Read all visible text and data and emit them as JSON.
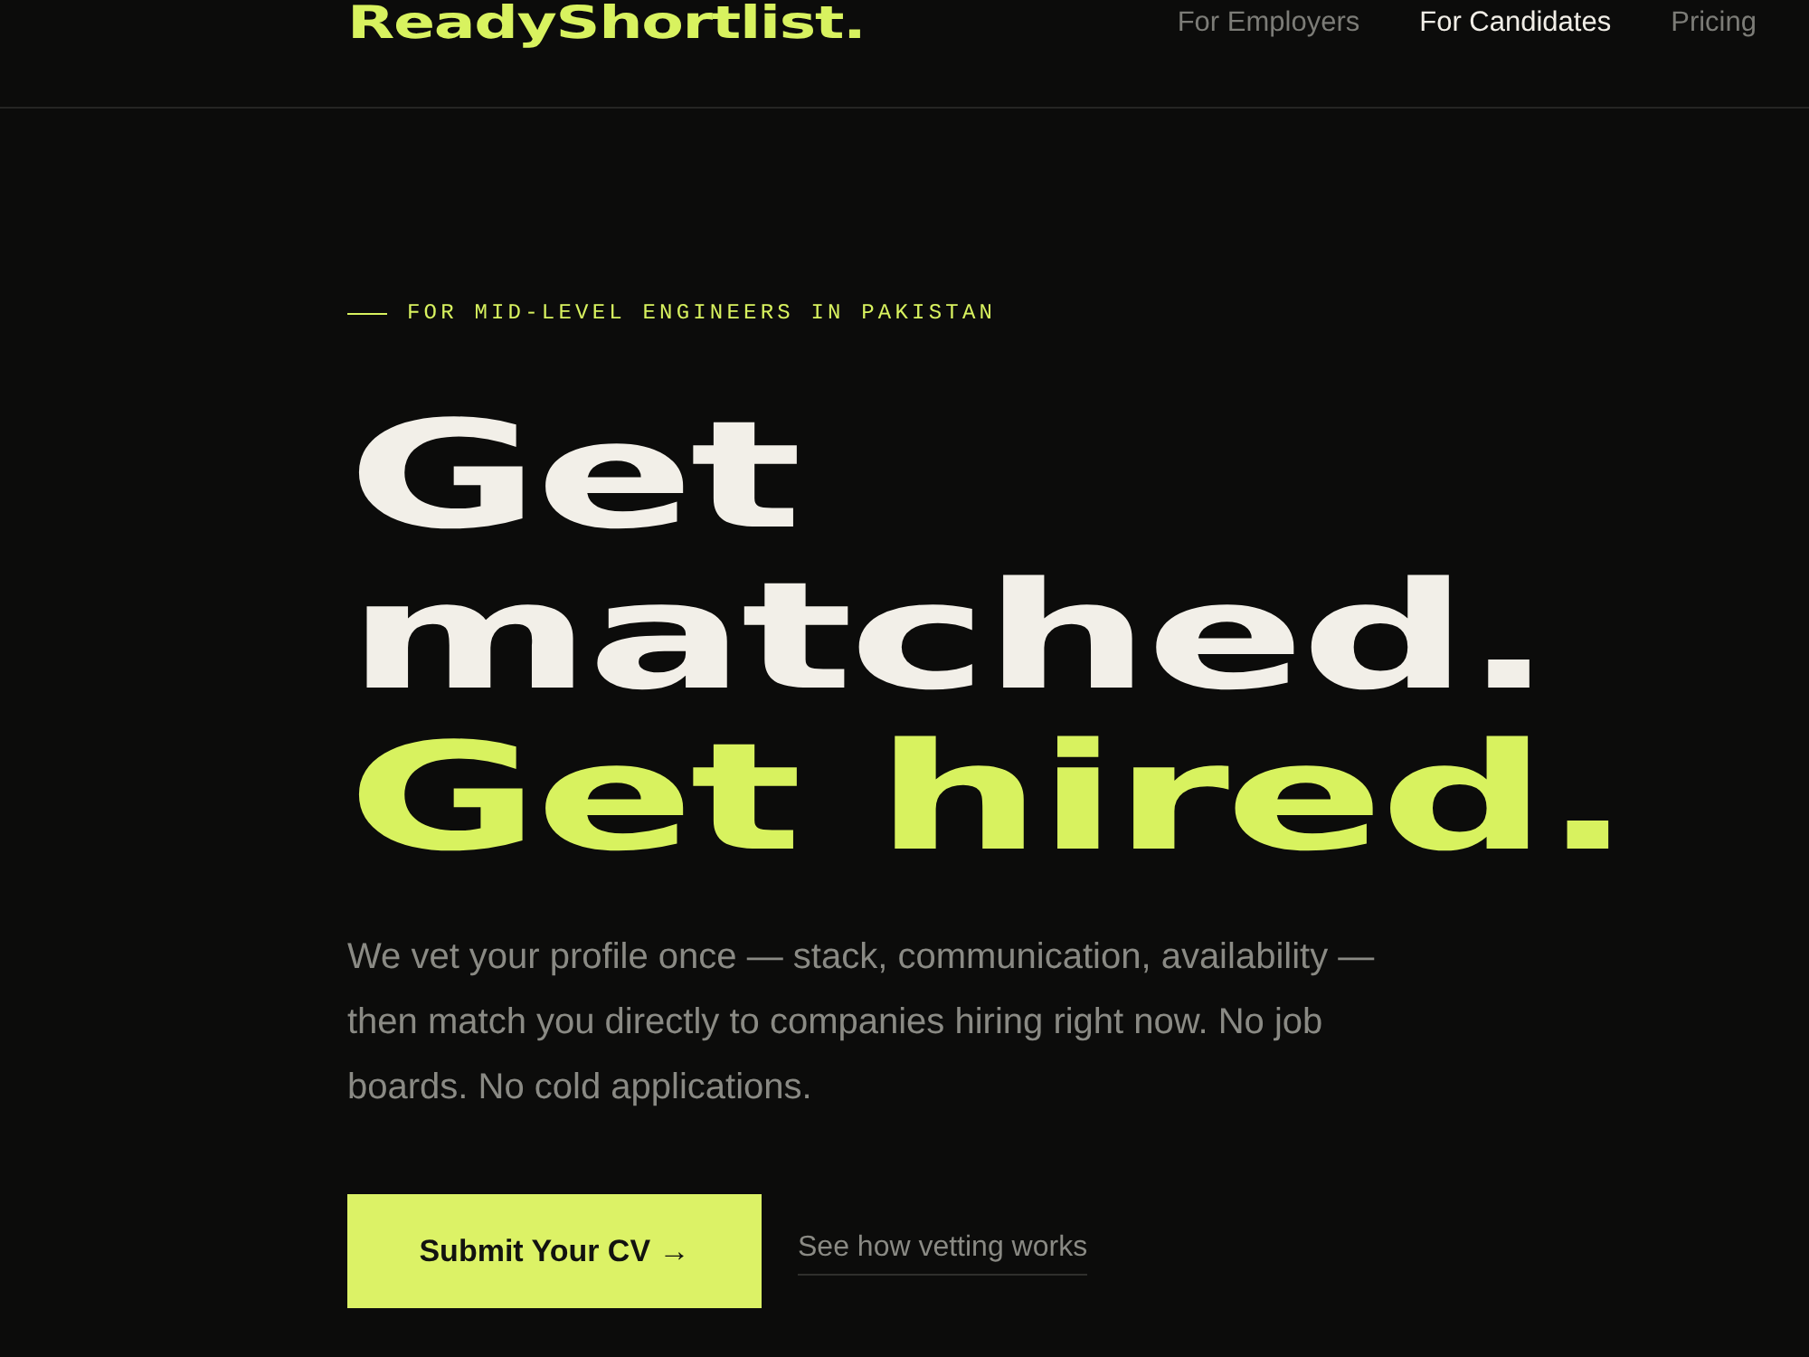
{
  "header": {
    "logo": "ReadyShortlist.",
    "nav": [
      {
        "label": "For Employers",
        "selected": false
      },
      {
        "label": "For Candidates",
        "selected": true
      },
      {
        "label": "Pricing",
        "selected": false
      }
    ]
  },
  "hero": {
    "eyebrow": "FOR MID-LEVEL ENGINEERS IN PAKISTAN",
    "headline": [
      {
        "text": "Get",
        "accent": false
      },
      {
        "text": "matched.",
        "accent": false
      },
      {
        "text": "Get hired.",
        "accent": true
      }
    ],
    "description": "We vet your profile once — stack, communication, availability — then match you directly to companies hiring right now. No job boards. No cold applications.",
    "primary_button": "Submit Your CV →",
    "secondary_link": "See how vetting works"
  }
}
